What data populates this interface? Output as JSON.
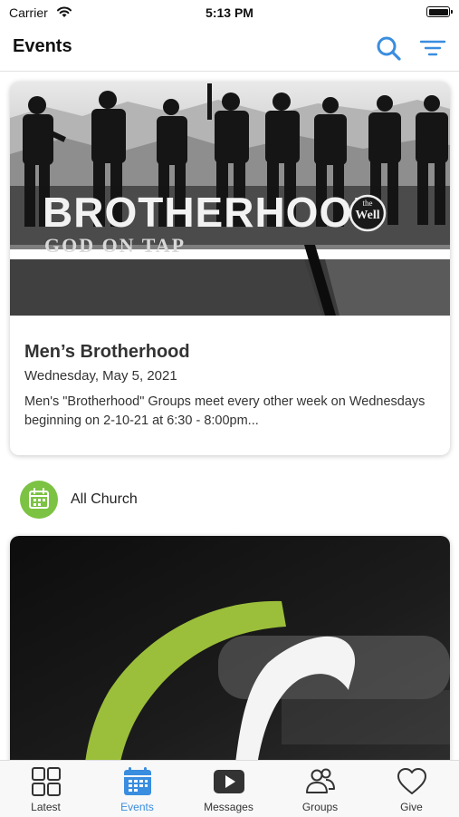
{
  "status_bar": {
    "carrier": "Carrier",
    "time": "5:13 PM"
  },
  "nav": {
    "title": "Events"
  },
  "events": [
    {
      "title": "Men’s Brotherhood",
      "date": "Wednesday, May 5, 2021",
      "description": "Men's \"Brotherhood\" Groups meet every other week on Wednesdays beginning on 2-10-21 at 6:30 - 8:00pm...",
      "image_text": {
        "headline": "BROTHERHOOD",
        "sub": "GOD ON TAP",
        "logo_line1": "the",
        "logo_line2": "Well"
      }
    }
  ],
  "category": {
    "label": "All Church"
  },
  "tabs": [
    {
      "label": "Latest",
      "icon": "grid-icon",
      "active": false
    },
    {
      "label": "Events",
      "icon": "calendar-icon",
      "active": true
    },
    {
      "label": "Messages",
      "icon": "play-icon",
      "active": false
    },
    {
      "label": "Groups",
      "icon": "people-icon",
      "active": false
    },
    {
      "label": "Give",
      "icon": "heart-icon",
      "active": false
    }
  ],
  "colors": {
    "accent": "#3a8ddf",
    "category_green": "#7cc243",
    "logo_green": "#9bbf3a"
  }
}
